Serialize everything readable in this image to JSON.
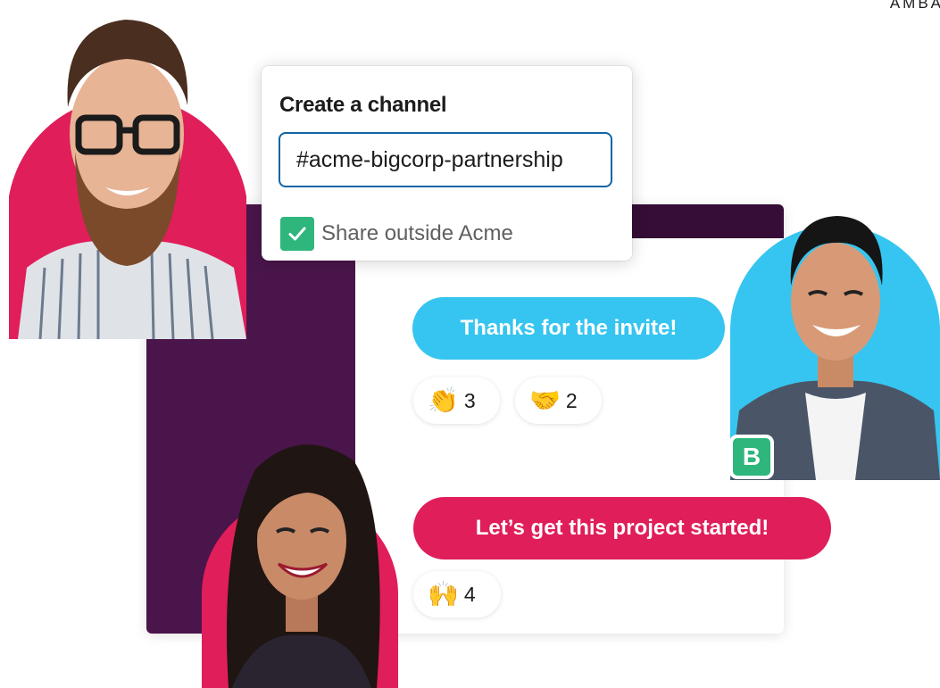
{
  "corner_text": "AMBA",
  "modal": {
    "title": "Create a channel",
    "channel_name": "#acme-bigcorp-partnership",
    "share_label": "Share outside Acme",
    "share_checked": true
  },
  "messages": [
    {
      "text": "Thanks for the invite!",
      "color": "#36c5f0",
      "reactions": [
        {
          "emoji": "👏",
          "count": "3"
        },
        {
          "emoji": "🤝",
          "count": "2"
        }
      ]
    },
    {
      "text": "Let’s get this project started!",
      "color": "#e01e5a",
      "reactions": [
        {
          "emoji": "🙌",
          "count": "4"
        }
      ]
    }
  ],
  "badge": {
    "letter": "B",
    "color": "#2eb67d"
  },
  "avatars": [
    {
      "icon": "bearded-man-avatar",
      "bg": "#e01e5a"
    },
    {
      "icon": "smiling-man-avatar",
      "bg": "#36c5f0"
    },
    {
      "icon": "smiling-woman-avatar",
      "bg": "#e01e5a"
    }
  ],
  "colors": {
    "sidebar": "#4a154b",
    "topbar": "#350d36",
    "input_border": "#1164a3"
  }
}
